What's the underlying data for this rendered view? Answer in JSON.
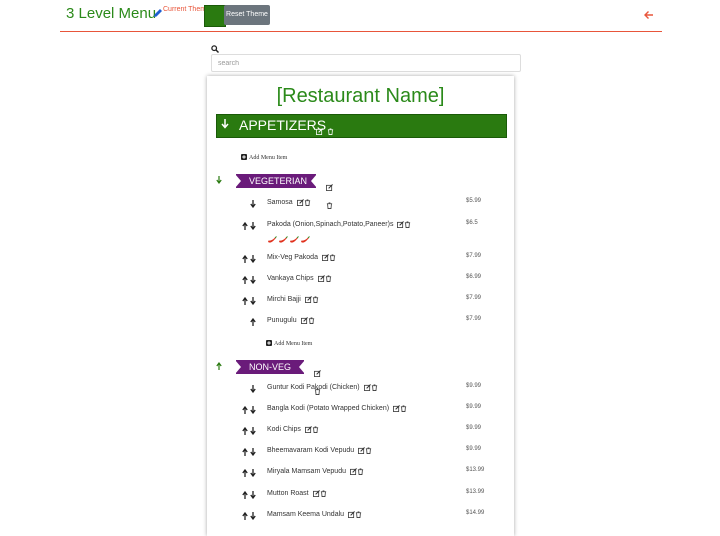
{
  "header": {
    "title": "3 Level Menu",
    "current_theme_label": "Current Theme",
    "reset_theme_label": "Reset Theme",
    "theme_color": "#2a7a10",
    "accent_color": "#e8553a"
  },
  "search": {
    "placeholder": "search"
  },
  "menu": {
    "restaurant_name": "[Restaurant Name]",
    "level1_title": "APPETIZERS",
    "add_item_label": "Add Menu Item",
    "sections": [
      {
        "name": "VEGETERIAN",
        "items": [
          {
            "name": "Samosa",
            "price": "$5.99",
            "arrows": "down"
          },
          {
            "name": "Pakoda (Onion,Spinach,Potato,Paneer)s",
            "price": "$6.5",
            "arrows": "both",
            "spice": 4
          },
          {
            "name": "Mix-Veg Pakoda",
            "price": "$7.99",
            "arrows": "both"
          },
          {
            "name": "Vankaya Chips",
            "price": "$6.99",
            "arrows": "both"
          },
          {
            "name": "Mirchi Bajji",
            "price": "$7.99",
            "arrows": "both"
          },
          {
            "name": "Punugulu",
            "price": "$7.99",
            "arrows": "up"
          }
        ]
      },
      {
        "name": "NON-VEG",
        "items": [
          {
            "name": "Guntur Kodi Pakodi (Chicken)",
            "price": "$9.99",
            "arrows": "down"
          },
          {
            "name": "Bangla Kodi (Potato Wrapped Chicken)",
            "price": "$9.99",
            "arrows": "both"
          },
          {
            "name": "Kodi Chips",
            "price": "$9.99",
            "arrows": "both"
          },
          {
            "name": "Bheemavaram Kodi Vepudu",
            "price": "$9.99",
            "arrows": "both"
          },
          {
            "name": "Miryala Mamsam Vepudu",
            "price": "$13.99",
            "arrows": "both"
          },
          {
            "name": "Mutton Roast",
            "price": "$13.99",
            "arrows": "both"
          },
          {
            "name": "Mamsam Keema Undalu",
            "price": "$14.99",
            "arrows": "both"
          }
        ]
      }
    ]
  }
}
